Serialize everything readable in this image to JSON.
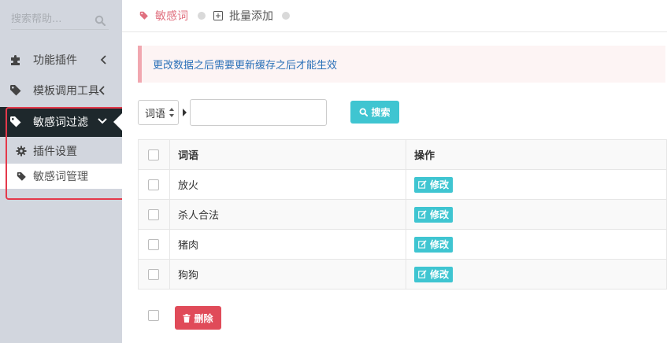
{
  "sidebar": {
    "search_placeholder": "搜索帮助...",
    "items": [
      {
        "label": "功能插件",
        "icon": "puzzle-icon"
      },
      {
        "label": "模板调用工具",
        "icon": "tag-icon"
      },
      {
        "label": "敏感词过滤",
        "icon": "tag-icon",
        "active": true
      }
    ],
    "subitems": [
      {
        "label": "插件设置",
        "icon": "gear-icon"
      },
      {
        "label": "敏感词管理",
        "icon": "tag-icon",
        "selected": true
      }
    ]
  },
  "tabs": {
    "active_label": "敏感词",
    "batch_label": "批量添加"
  },
  "notice": "更改数据之后需要更新缓存之后才能生效",
  "filter": {
    "select_value": "词语",
    "input_value": "",
    "search_button": "搜索"
  },
  "table": {
    "headers": {
      "word": "词语",
      "action": "操作"
    },
    "rows": [
      {
        "word": "放火",
        "action": "修改"
      },
      {
        "word": "杀人合法",
        "action": "修改"
      },
      {
        "word": "猪肉",
        "action": "修改"
      },
      {
        "word": "狗狗",
        "action": "修改"
      }
    ]
  },
  "footer": {
    "delete_button": "删除"
  },
  "colors": {
    "sidebar_bg": "#d2d6de",
    "active_item_bg": "#1e282c",
    "accent_teal": "#3fc5d1",
    "danger_red": "#e04b59",
    "tab_active": "#e0707f",
    "notice_text": "#2a70b8",
    "highlight_border": "#e4394b"
  }
}
